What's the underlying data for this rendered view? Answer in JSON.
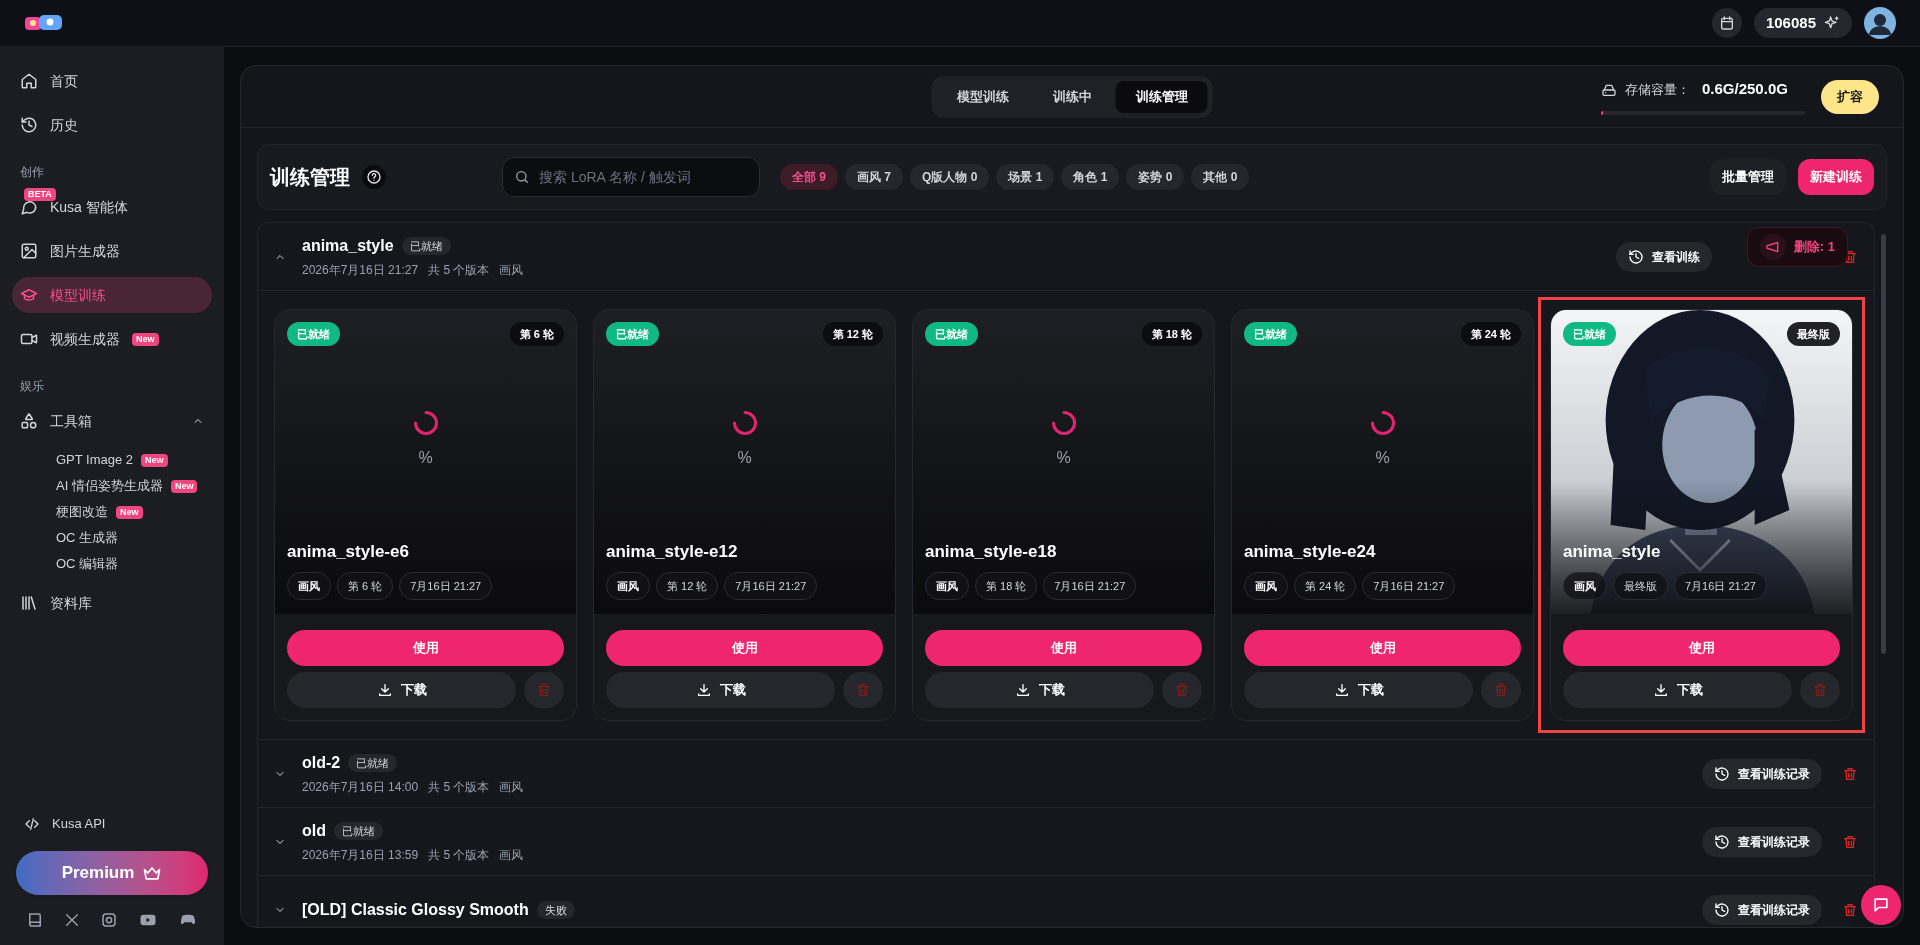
{
  "topbar": {
    "credits": "106085"
  },
  "sidebar": {
    "items": [
      {
        "kind": "item",
        "label": "首页",
        "selected": false
      },
      {
        "kind": "item",
        "label": "历史",
        "selected": false
      },
      {
        "kind": "section",
        "label": "创作"
      },
      {
        "kind": "item",
        "label": "Kusa 智能体",
        "badge": "BETA",
        "selected": false
      },
      {
        "kind": "item",
        "label": "图片生成器",
        "selected": false
      },
      {
        "kind": "item",
        "label": "模型训练",
        "selected": true
      },
      {
        "kind": "item",
        "label": "视频生成器",
        "tag": "New",
        "selected": false
      },
      {
        "kind": "section",
        "label": "娱乐"
      },
      {
        "kind": "item",
        "label": "工具箱",
        "selected": false,
        "expanded": true,
        "children": [
          {
            "label": "GPT Image 2",
            "tag": "New"
          },
          {
            "label": "AI 情侣姿势生成器",
            "tag": "New"
          },
          {
            "label": "梗图改造",
            "tag": "New"
          },
          {
            "label": "OC 生成器"
          },
          {
            "label": "OC 编辑器"
          }
        ]
      },
      {
        "kind": "item",
        "label": "资料库",
        "selected": false
      }
    ],
    "api_link": "Kusa API",
    "premium_button": "Premium"
  },
  "tabs": [
    {
      "label": "模型训练",
      "selected": false
    },
    {
      "label": "训练中",
      "selected": false
    },
    {
      "label": "训练管理",
      "selected": true
    }
  ],
  "storage": {
    "label": "存储容量：",
    "value": "0.6G/250.0G",
    "level": 0.0024,
    "button": "扩容"
  },
  "header": {
    "title": "训练管理",
    "search": {
      "placeholder": "搜索 LoRA 名称 / 触发词"
    },
    "filters": [
      {
        "label": "全部 9",
        "selected": true
      },
      {
        "label": "画风 7",
        "selected": false
      },
      {
        "label": "Q版人物 0",
        "selected": false
      },
      {
        "label": "场景 1",
        "selected": false
      },
      {
        "label": "角色 1",
        "selected": false
      },
      {
        "label": "姿势 0",
        "selected": false
      },
      {
        "label": "其他 0",
        "selected": false
      }
    ],
    "buttons": [
      {
        "kind": "secondary",
        "label": "批量管理"
      },
      {
        "kind": "primary",
        "label": "新建训练"
      }
    ]
  },
  "toast": "删除: 1",
  "groups": [
    {
      "name": "anima_style",
      "status": "已就绪",
      "meta": [
        "2026年7月16日 21:27",
        "共 5 个版本",
        "画风"
      ],
      "record_button": "查看训练",
      "expanded": true,
      "versions": [
        {
          "kind": "loading",
          "status": "已就绪",
          "badge": "第 6 轮",
          "progress": "%",
          "title": "anima_style-e6",
          "tags": [
            "画风",
            "第 6 轮",
            "7月16日 21:27"
          ],
          "use": "使用",
          "download": "下载",
          "highlighted": false
        },
        {
          "kind": "loading",
          "status": "已就绪",
          "badge": "第 12 轮",
          "progress": "%",
          "title": "anima_style-e12",
          "tags": [
            "画风",
            "第 12 轮",
            "7月16日 21:27"
          ],
          "use": "使用",
          "download": "下载",
          "highlighted": false
        },
        {
          "kind": "loading",
          "status": "已就绪",
          "badge": "第 18 轮",
          "progress": "%",
          "title": "anima_style-e18",
          "tags": [
            "画风",
            "第 18 轮",
            "7月16日 21:27"
          ],
          "use": "使用",
          "download": "下载",
          "highlighted": false
        },
        {
          "kind": "loading",
          "status": "已就绪",
          "badge": "第 24 轮",
          "progress": "%",
          "title": "anima_style-e24",
          "tags": [
            "画风",
            "第 24 轮",
            "7月16日 21:27"
          ],
          "use": "使用",
          "download": "下载",
          "highlighted": false
        },
        {
          "kind": "picture",
          "status": "已就绪",
          "badge": "最终版",
          "title": "anima_style",
          "tags": [
            "画风",
            "最终版",
            "7月16日 21:27"
          ],
          "use": "使用",
          "download": "下载",
          "highlighted": true
        }
      ]
    },
    {
      "name": "old-2",
      "status": "已就绪",
      "meta": [
        "2026年7月16日 14:00",
        "共 5 个版本",
        "画风"
      ],
      "record_button": "查看训练记录",
      "expanded": false
    },
    {
      "name": "old",
      "status": "已就绪",
      "meta": [
        "2026年7月16日 13:59",
        "共 5 个版本",
        "画风"
      ],
      "record_button": "查看训练记录",
      "expanded": false
    },
    {
      "name": "[OLD] Classic Glossy Smooth",
      "status": "失败",
      "record_button": "查看训练记录",
      "expanded": false
    }
  ]
}
